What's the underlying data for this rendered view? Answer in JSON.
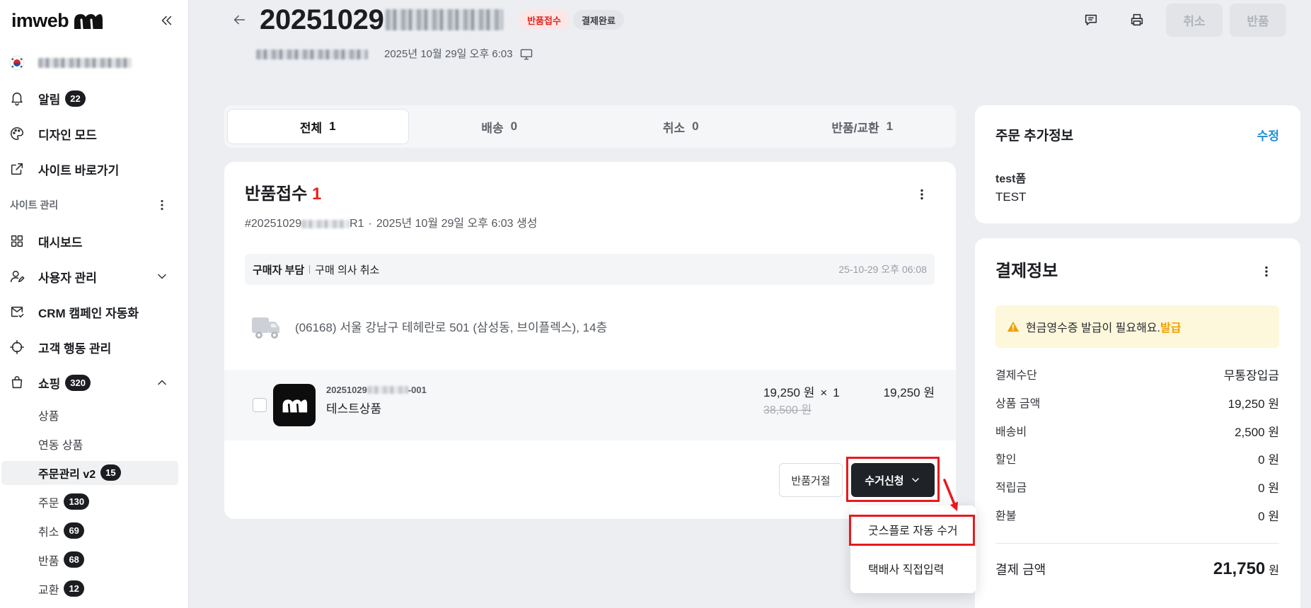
{
  "sidebar": {
    "brand": "imweb",
    "top_items": [
      {
        "label": "알림",
        "badge": "22",
        "icon": "bell-icon"
      },
      {
        "label": "디자인 모드",
        "icon": "palette-icon"
      },
      {
        "label": "사이트 바로가기",
        "icon": "external-link-icon"
      }
    ],
    "section_label": "사이트 관리",
    "menu": [
      {
        "label": "대시보드",
        "icon": "grid-icon"
      },
      {
        "label": "사용자 관리",
        "icon": "user-edit-icon"
      },
      {
        "label": "CRM 캠페인 자동화",
        "icon": "mail-icon"
      },
      {
        "label": "고객 행동 관리",
        "icon": "crosshair-icon"
      },
      {
        "label": "쇼핑",
        "badge": "320",
        "icon": "shopping-bag-icon"
      }
    ],
    "shopping_sub": [
      {
        "label": "상품"
      },
      {
        "label": "연동 상품"
      },
      {
        "label": "주문관리 v2",
        "badge": "15",
        "active": true
      },
      {
        "label": "주문",
        "badge": "130"
      },
      {
        "label": "취소",
        "badge": "69"
      },
      {
        "label": "반품",
        "badge": "68"
      },
      {
        "label": "교환",
        "badge": "12"
      }
    ]
  },
  "header": {
    "order_no_visible": "20251029",
    "status_badge": "반품접수",
    "payment_badge": "결제완료",
    "created_at": "2025년 10월 29일 오후 6:03",
    "cancel_button": "취소",
    "return_button": "반품"
  },
  "tabs": [
    {
      "label": "전체",
      "count": "1",
      "active": true
    },
    {
      "label": "배송",
      "count": "0"
    },
    {
      "label": "취소",
      "count": "0"
    },
    {
      "label": "반품/교환",
      "count": "1"
    }
  ],
  "return_card": {
    "title": "반품접수",
    "count": "1",
    "order_ref_prefix": "#20251029",
    "order_ref_suffix": "R1",
    "separator": "·",
    "created": "2025년 10월 29일 오후 6:03 생성",
    "reason_payer": "구매자 부담",
    "reason": "구매 의사 취소",
    "reason_time": "25-10-29 오후 06:08",
    "address": "(06168) 서울 강남구 테헤란로 501 (삼성동, 브이플렉스), 14층",
    "item": {
      "code_prefix": "20251029",
      "code_suffix": "-001",
      "name": "테스트상품",
      "unit_price": "19,250 원",
      "times": "×",
      "quantity": "1",
      "original_price": "38,500 원",
      "total": "19,250 원"
    },
    "reject_button": "반품거절",
    "pickup_button": "수거신청"
  },
  "pickup_menu": {
    "items": [
      "굿스플로 자동 수거",
      "택배사 직접입력"
    ]
  },
  "extra_info": {
    "title": "주문 추가정보",
    "edit": "수정",
    "field_label": "test폼",
    "field_value": "TEST"
  },
  "payment": {
    "title": "결제정보",
    "notice": "현금영수증 발급이 필요해요.",
    "notice_action": "발급",
    "rows": [
      {
        "label": "결제수단",
        "value": "무통장입금"
      },
      {
        "label": "상품 금액",
        "value": "19,250 원"
      },
      {
        "label": "배송비",
        "value": "2,500 원"
      },
      {
        "label": "할인",
        "value": "0 원"
      },
      {
        "label": "적립금",
        "value": "0 원"
      },
      {
        "label": "환불",
        "value": "0 원"
      }
    ],
    "total_label": "결제 금액",
    "total_value": "21,750",
    "total_unit": "원"
  },
  "colors": {
    "accent_blue": "#1e8fd6",
    "count_red": "#e8211c",
    "warning_orange": "#f0a000",
    "annotation_red": "#e8191e",
    "dark_button": "#1f2227"
  }
}
